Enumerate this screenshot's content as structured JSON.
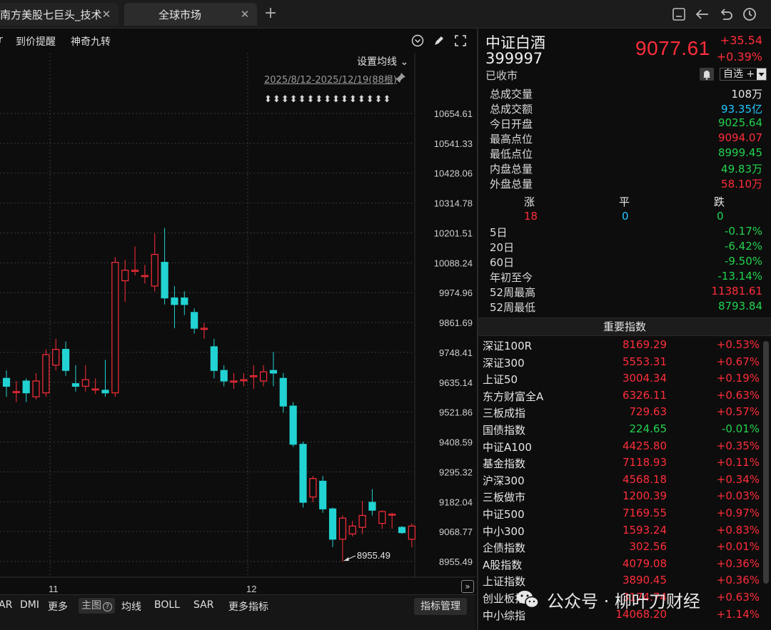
{
  "tabs": [
    {
      "label": "南方美股七巨头_技术",
      "active": false
    },
    {
      "label": "全球市场",
      "active": true
    }
  ],
  "toolbar": {
    "item_prefix": "r",
    "price_alert": "到价提醒",
    "nine_turn": "神奇九转"
  },
  "chart": {
    "ma_setting": "设置均线 ⌄",
    "date_range": "2025/8/12-2025/12/19(88根)",
    "arrows": "⬍⬍⬍⬍⬍⬍⬍⬍⬍⬍⬍⬍⬍⬍⬍",
    "low_annotation": "8955.49",
    "month_labels": [
      "11",
      "12"
    ]
  },
  "chart_data": {
    "type": "candlestick",
    "y_ticks": [
      "10654.61",
      "10541.33",
      "10428.06",
      "10314.78",
      "10201.51",
      "10088.24",
      "9974.96",
      "9861.69",
      "9748.41",
      "9635.14",
      "9521.86",
      "9408.59",
      "9295.32",
      "9182.04",
      "9068.77",
      "8955.49"
    ],
    "ylim": [
      8955.49,
      10654.61
    ],
    "x_labels": [
      "11",
      "12"
    ],
    "candles": [
      {
        "o": 9650,
        "c": 9620,
        "h": 9680,
        "l": 9580
      },
      {
        "o": 9600,
        "c": 9600,
        "h": 9640,
        "l": 9560
      },
      {
        "o": 9640,
        "c": 9595,
        "h": 9650,
        "l": 9560
      },
      {
        "o": 9580,
        "c": 9640,
        "h": 9670,
        "l": 9570
      },
      {
        "o": 9595,
        "c": 9740,
        "h": 9760,
        "l": 9580
      },
      {
        "o": 9700,
        "c": 9760,
        "h": 9800,
        "l": 9680
      },
      {
        "o": 9760,
        "c": 9680,
        "h": 9790,
        "l": 9660
      },
      {
        "o": 9630,
        "c": 9620,
        "h": 9700,
        "l": 9600
      },
      {
        "o": 9620,
        "c": 9645,
        "h": 9700,
        "l": 9600
      },
      {
        "o": 9610,
        "c": 9610,
        "h": 9650,
        "l": 9590
      },
      {
        "o": 9605,
        "c": 9595,
        "h": 9720,
        "l": 9580
      },
      {
        "o": 9595,
        "c": 10090,
        "h": 10110,
        "l": 9580
      },
      {
        "o": 10020,
        "c": 10060,
        "h": 10100,
        "l": 9940
      },
      {
        "o": 10060,
        "c": 10060,
        "h": 10150,
        "l": 10040
      },
      {
        "o": 10040,
        "c": 10040,
        "h": 10080,
        "l": 10010
      },
      {
        "o": 10000,
        "c": 10120,
        "h": 10200,
        "l": 9980
      },
      {
        "o": 10090,
        "c": 9955,
        "h": 10220,
        "l": 9930
      },
      {
        "o": 9955,
        "c": 9930,
        "h": 10000,
        "l": 9840
      },
      {
        "o": 9955,
        "c": 9930,
        "h": 9980,
        "l": 9890
      },
      {
        "o": 9900,
        "c": 9840,
        "h": 9915,
        "l": 9820
      },
      {
        "o": 9840,
        "c": 9840,
        "h": 9860,
        "l": 9800
      },
      {
        "o": 9770,
        "c": 9680,
        "h": 9800,
        "l": 9650
      },
      {
        "o": 9680,
        "c": 9640,
        "h": 9700,
        "l": 9620
      },
      {
        "o": 9640,
        "c": 9640,
        "h": 9670,
        "l": 9610
      },
      {
        "o": 9645,
        "c": 9645,
        "h": 9670,
        "l": 9620
      },
      {
        "o": 9660,
        "c": 9660,
        "h": 9700,
        "l": 9610
      },
      {
        "o": 9640,
        "c": 9675,
        "h": 9700,
        "l": 9620
      },
      {
        "o": 9680,
        "c": 9670,
        "h": 9750,
        "l": 9620
      },
      {
        "o": 9650,
        "c": 9545,
        "h": 9670,
        "l": 9520
      },
      {
        "o": 9545,
        "c": 9400,
        "h": 9560,
        "l": 9390
      },
      {
        "o": 9400,
        "c": 9180,
        "h": 9410,
        "l": 9160
      },
      {
        "o": 9200,
        "c": 9270,
        "h": 9280,
        "l": 9180
      },
      {
        "o": 9260,
        "c": 9155,
        "h": 9280,
        "l": 9140
      },
      {
        "o": 9155,
        "c": 9040,
        "h": 9160,
        "l": 9010
      },
      {
        "o": 9040,
        "c": 9120,
        "h": 9130,
        "l": 8955.49
      },
      {
        "o": 9060,
        "c": 9090,
        "h": 9110,
        "l": 9050
      },
      {
        "o": 9085,
        "c": 9130,
        "h": 9185,
        "l": 9060
      },
      {
        "o": 9180,
        "c": 9150,
        "h": 9230,
        "l": 9130
      },
      {
        "o": 9100,
        "c": 9145,
        "h": 9150,
        "l": 9080
      },
      {
        "o": 9135,
        "c": 9135,
        "h": 9140,
        "l": 9080
      },
      {
        "o": 9085,
        "c": 9065,
        "h": 9090,
        "l": 9060
      },
      {
        "o": 9040,
        "c": 9090,
        "h": 9100,
        "l": 9010
      }
    ]
  },
  "bottom_bar": {
    "sar_left": "AR",
    "dmi": "DMI",
    "more": "更多",
    "main_chart": "主图",
    "main_help": "?",
    "ma": "均线",
    "boll": "BOLL",
    "sar": "SAR",
    "more_indicators": "更多指标",
    "manage": "指标管理"
  },
  "quote": {
    "name": "中证白酒",
    "code": "399997",
    "price": "9077.61",
    "change": "+35.54",
    "change_pct": "+0.39%",
    "status": "已收市",
    "watchlist_label": "自选 +",
    "stats": [
      {
        "k": "总成交量",
        "v": "108万",
        "color": "white"
      },
      {
        "k": "总成交额",
        "v": "93.35亿",
        "color": "cyan"
      },
      {
        "k": "今日开盘",
        "v": "9025.64",
        "color": "green"
      },
      {
        "k": "最高点位",
        "v": "9094.07",
        "color": "red"
      },
      {
        "k": "最低点位",
        "v": "8999.45",
        "color": "green"
      },
      {
        "k": "内盘总量",
        "v": "49.83万",
        "color": "green"
      },
      {
        "k": "外盘总量",
        "v": "58.10万",
        "color": "red"
      }
    ],
    "breadth": {
      "up_label": "涨",
      "flat_label": "平",
      "down_label": "跌",
      "up": "18",
      "flat": "0",
      "down": "0"
    },
    "periods": [
      {
        "k": "5日",
        "v": "-0.17%",
        "color": "green"
      },
      {
        "k": "20日",
        "v": "-6.42%",
        "color": "green"
      },
      {
        "k": "60日",
        "v": "-9.50%",
        "color": "green"
      },
      {
        "k": "年初至今",
        "v": "-13.14%",
        "color": "green"
      },
      {
        "k": "52周最高",
        "v": "11381.61",
        "color": "red"
      },
      {
        "k": "52周最低",
        "v": "8793.84",
        "color": "green"
      }
    ]
  },
  "indices_title": "重要指数",
  "indices": [
    {
      "name": "深证100R",
      "price": "8169.29",
      "pct": "+0.53%",
      "color": "red"
    },
    {
      "name": "深证300",
      "price": "5553.31",
      "pct": "+0.67%",
      "color": "red"
    },
    {
      "name": "上证50",
      "price": "3004.34",
      "pct": "+0.19%",
      "color": "red"
    },
    {
      "name": "东方财富全A",
      "price": "6326.11",
      "pct": "+0.63%",
      "color": "red"
    },
    {
      "name": "三板成指",
      "price": "729.63",
      "pct": "+0.57%",
      "color": "red"
    },
    {
      "name": "国债指数",
      "price": "224.65",
      "pct": "-0.01%",
      "color": "green"
    },
    {
      "name": "中证A100",
      "price": "4425.80",
      "pct": "+0.35%",
      "color": "red"
    },
    {
      "name": "基金指数",
      "price": "7118.93",
      "pct": "+0.11%",
      "color": "red"
    },
    {
      "name": "沪深300",
      "price": "4568.18",
      "pct": "+0.34%",
      "color": "red"
    },
    {
      "name": "三板做市",
      "price": "1200.39",
      "pct": "+0.03%",
      "color": "red"
    },
    {
      "name": "中证500",
      "price": "7169.55",
      "pct": "+0.97%",
      "color": "red"
    },
    {
      "name": "中小300",
      "price": "1593.24",
      "pct": "+0.83%",
      "color": "red"
    },
    {
      "name": "企债指数",
      "price": "302.56",
      "pct": "+0.01%",
      "color": "red"
    },
    {
      "name": "A股指数",
      "price": "4079.08",
      "pct": "+0.36%",
      "color": "red"
    },
    {
      "name": "上证指数",
      "price": "3890.45",
      "pct": "+0.36%",
      "color": "red"
    },
    {
      "name": "创业板指",
      "price": "3174.74",
      "pct": "+0.63%",
      "color": "red"
    },
    {
      "name": "中小综指",
      "price": "14068.20",
      "pct": "+1.14%",
      "color": "red"
    }
  ],
  "watermark": {
    "text": "公众号 · 柳叶刀财经"
  },
  "colors": {
    "up": "#ff2d3a",
    "down": "#22d3d3",
    "grid": "#3a3a3a",
    "background": "#0d0d0d"
  }
}
